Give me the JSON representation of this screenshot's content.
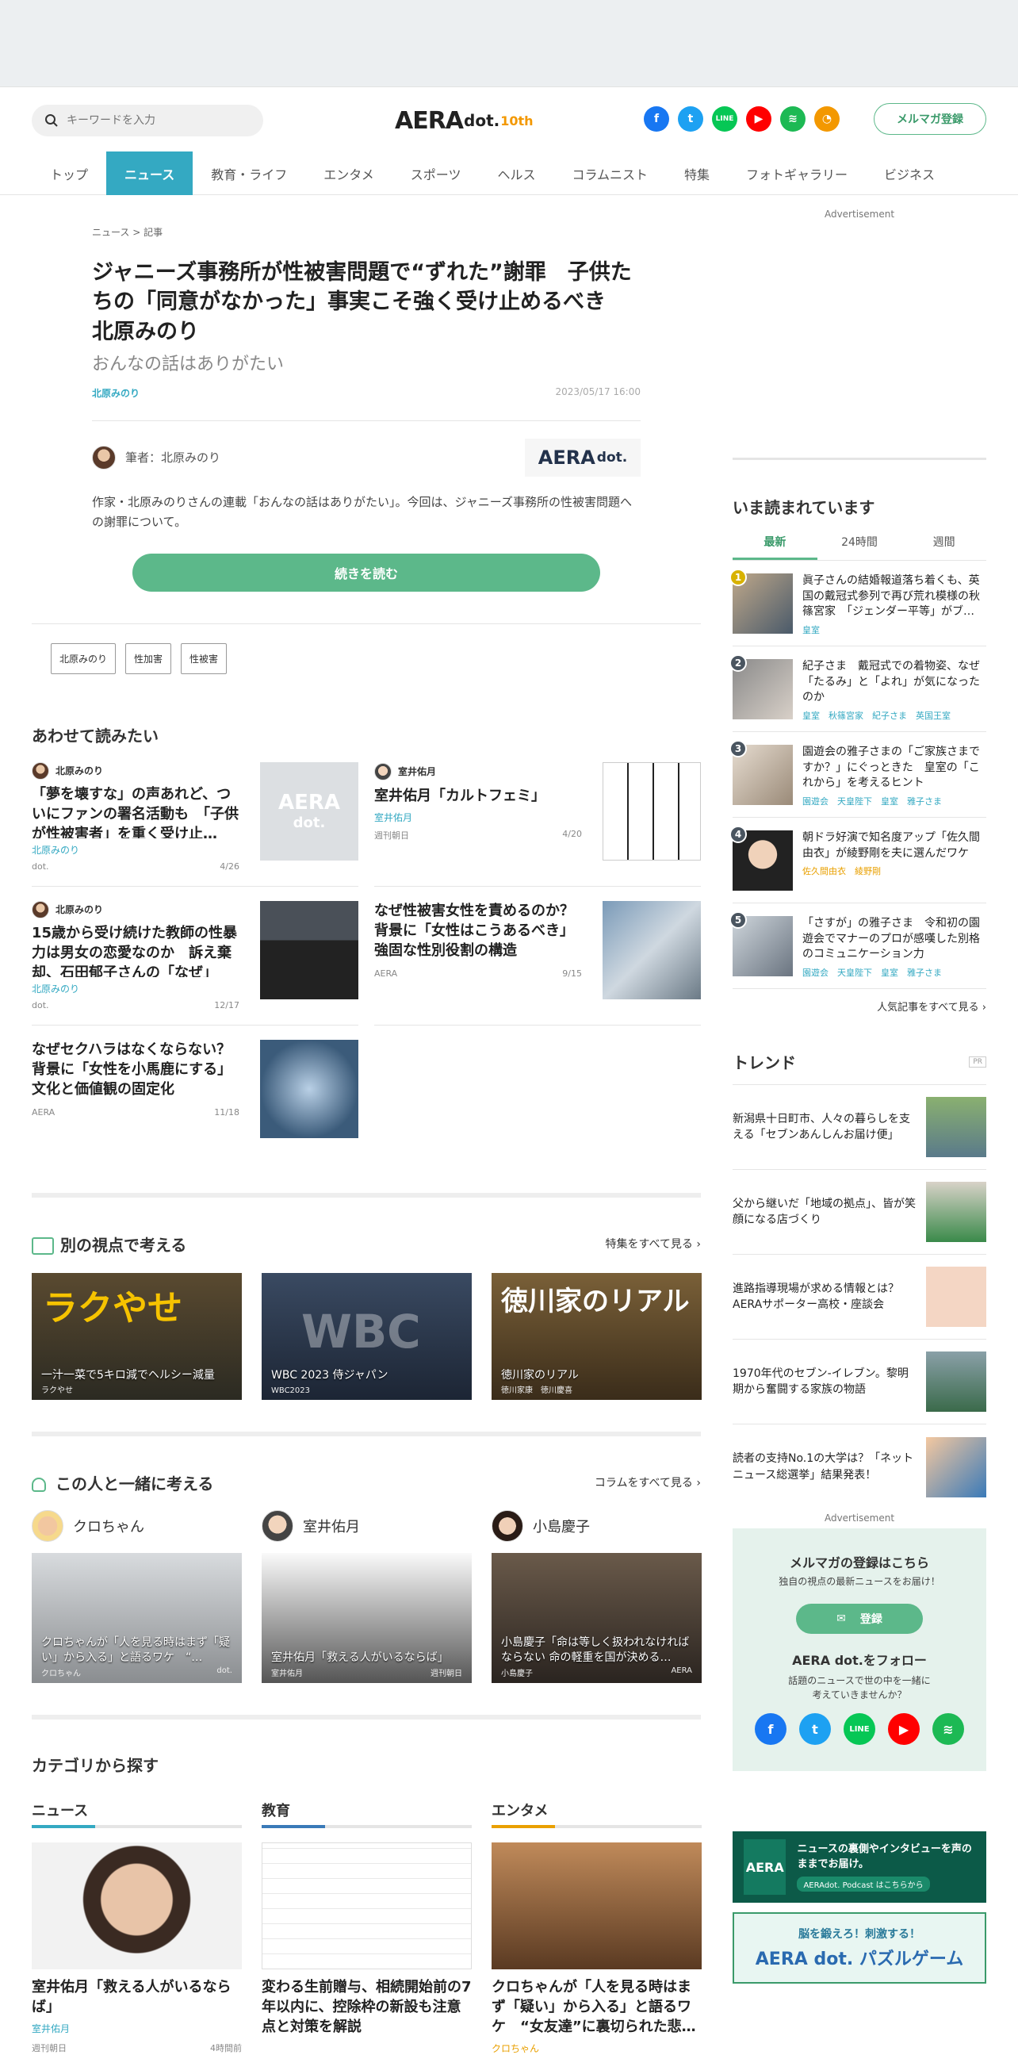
{
  "header": {
    "search_placeholder": "キーワードを入力",
    "logo": {
      "aera": "AERA",
      "dot": "dot.",
      "ten": "10th"
    },
    "newsletter_button": "メルマガ登録"
  },
  "nav": [
    "トップ",
    "ニュース",
    "教育・ライフ",
    "エンタメ",
    "スポーツ",
    "ヘルス",
    "コラムニスト",
    "特集",
    "フォトギャラリー",
    "ビジネス"
  ],
  "article": {
    "breadcrumb": "ニュース > 記事",
    "title": "ジャニーズ事務所が性被害問題で“ずれた”謝罪　子供たちの「同意がなかった」事実こそ強く受け止めるべき　北原みのり",
    "subtitle": "おんなの話はありがたい",
    "author_link": "北原みのり",
    "date": "2023/05/17 16:00",
    "byline": "筆者：北原みのり",
    "publisher": "AERA",
    "publisher_dot": "dot.",
    "lead": "作家・北原みのりさんの連載「おんなの話はありがたい」。今回は、ジャニーズ事務所の性被害問題への謝罪について。",
    "read_more": "続きを読む",
    "tags": [
      "北原みのり",
      "性加害",
      "性被害"
    ]
  },
  "related": {
    "heading": "あわせて読みたい",
    "items": [
      {
        "author": "北原みのり",
        "title": "「夢を壊すな」の声あれど、ついにファンの署名活動も　「子供が性被害者」を重く受け止…",
        "category": "北原みのり",
        "source": "dot.",
        "date": "4/26"
      },
      {
        "author": "室井佑月",
        "title": "室井佑月「カルトフェミ」",
        "category": "室井佑月",
        "source": "週刊朝日",
        "date": "4/20"
      },
      {
        "author": "北原みのり",
        "title": "15歳から受け続けた教師の性暴力は男女の恋愛なのか　訴え棄却、石田郁子さんの「なぜ」",
        "category": "北原みのり",
        "source": "dot.",
        "date": "12/17"
      },
      {
        "author": "",
        "title": "なぜ性被害女性を責めるのか？背景に「女性はこうあるべき」強固な性別役割の構造",
        "category": "",
        "source": "AERA",
        "date": "9/15"
      },
      {
        "author": "",
        "title": "なぜセクハラはなくならない？背景に「女性を小馬鹿にする」文化と価値観の固定化",
        "category": "",
        "source": "AERA",
        "date": "11/18"
      }
    ]
  },
  "features": {
    "heading": "別の視点で考える",
    "more": "特集をすべて見る",
    "items": [
      {
        "title": "一汁一菜で5キロ減でヘルシー減量",
        "sub": "ラクやせ",
        "overlay": "ラクやせ"
      },
      {
        "title": "WBC 2023 侍ジャパン",
        "sub": "WBC2023",
        "overlay": "WBC"
      },
      {
        "title": "徳川家のリアル",
        "sub": "徳川家康　徳川慶喜",
        "overlay": "徳川家のリアル"
      }
    ]
  },
  "people": {
    "heading": "この人と一緒に考える",
    "more": "コラムをすべて見る",
    "items": [
      {
        "name": "クロちゃん",
        "title": "クロちゃんが「人を見る時はまず「疑い」から入る」と語るワケ　“…",
        "by": "クロちゃん",
        "src": "dot."
      },
      {
        "name": "室井佑月",
        "title": "室井佑月「救える人がいるならば」",
        "by": "室井佑月",
        "src": "週刊朝日"
      },
      {
        "name": "小島慶子",
        "title": "小島慶子「命は等しく扱われなければならない 命の軽重を国が決める…",
        "by": "小島慶子",
        "src": "AERA"
      }
    ]
  },
  "categories": {
    "heading": "カテゴリから探す",
    "items": [
      {
        "name": "ニュース",
        "title": "室井佑月「救える人がいるならば」",
        "tag": "室井佑月",
        "src": "週刊朝日",
        "time": "4時間前",
        "color": "#34a9c2"
      },
      {
        "name": "教育",
        "title": "変わる生前贈与、相続開始前の7年以内に、控除枠の新設も注意点と対策を解説",
        "tag": "",
        "src": "",
        "time": "",
        "color": "#3a7ab8"
      },
      {
        "name": "エンタメ",
        "title": "クロちゃんが「人を見る時はまず「疑い」から入る」と語るワケ　“女友達”に裏切られた悲…",
        "tag": "クロちゃん",
        "src": "",
        "time": "",
        "color": "#e9a000"
      }
    ]
  },
  "sidebar": {
    "ad_label": "Advertisement",
    "ranking": {
      "heading": "いま読まれています",
      "tabs": [
        "最新",
        "24時間",
        "週間"
      ],
      "items": [
        {
          "n": "1",
          "title": "眞子さんの結婚報道落ち着くも、英国の戴冠式参列で再び荒れ模様の秋篠宮家　「ジェンダー平等」がブ…",
          "tags": "皇室"
        },
        {
          "n": "2",
          "title": "紀子さま　戴冠式での着物姿、なぜ「たるみ」と「よれ」が気になったのか",
          "tags": "皇室　秋篠宮家　紀子さま　英国王室"
        },
        {
          "n": "3",
          "title": "園遊会の雅子さまの「ご家族さまですか？」にぐっときた　皇室の「これから」を考えるヒント",
          "tags": "園遊会　天皇陛下　皇室　雅子さま"
        },
        {
          "n": "4",
          "title": "朝ドラ好演で知名度アップ「佐久間由衣」が綾野剛を夫に選んだワケ",
          "tags": "佐久間由衣　綾野剛"
        },
        {
          "n": "5",
          "title": "「さすが」の雅子さま　令和初の園遊会でマナーのプロが感嘆した別格のコミュニケーション力",
          "tags": "園遊会　天皇陛下　皇室　雅子さま"
        }
      ],
      "more": "人気記事をすべて見る"
    },
    "trend": {
      "heading": "トレンド",
      "pr": "PR",
      "items": [
        "新潟県十日町市、人々の暮らしを支える「セブンあんしんお届け便」",
        "父から継いだ「地域の拠点」、皆が笑顔になる店づくり",
        "進路指導現場が求める情報とは？AERAサポーター高校・座談会",
        "1970年代のセブン-イレブン。黎明期から奮闘する家族の物語",
        "読者の支持No.1の大学は？「ネットニュース総選挙」結果発表！"
      ]
    },
    "newsletter": {
      "title": "メルマガの登録はこちら",
      "sub": "独自の視点の最新ニュースをお届け！",
      "button": "登録",
      "follow": "AERA dot.をフォロー",
      "follow_sub": "話題のニュースで世の中を一緒に考えていきませんか？"
    },
    "banners": {
      "podcast": "ニュースの裏側やインタビューを声のままでお届け。",
      "podcast_link": "AERAdot. Podcast はこちらから",
      "puzzle_sub": "脳を鍛えろ！刺激する！",
      "puzzle": "AERA dot. パズルゲーム"
    }
  },
  "colors": {
    "accent": "#34a9c2",
    "green": "#5cb88a"
  }
}
